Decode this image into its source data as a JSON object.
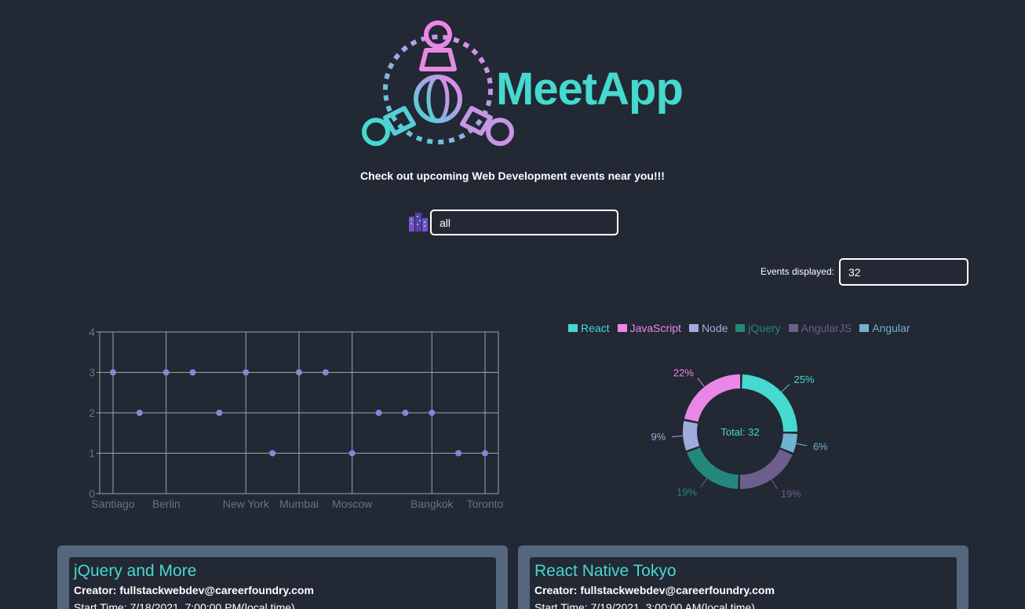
{
  "app": {
    "logo_text": "MeetApp",
    "tagline": "Check out upcoming Web Development events near you!!!"
  },
  "search": {
    "city_value": "all",
    "number_label": "Events displayed:",
    "number_value": "32"
  },
  "colors": {
    "accent": "#45d9cf",
    "background": "#222834",
    "card": "#54677f",
    "point": "#8884d8"
  },
  "scatter": {
    "chart_data": {
      "type": "scatter",
      "x": [
        "Santiago",
        "c2",
        "Berlin",
        "c4",
        "c5",
        "New York",
        "c7",
        "Mumbai",
        "c9",
        "Moscow",
        "c11",
        "c12",
        "Bangkok",
        "c14",
        "Toronto"
      ],
      "xtick_labels": [
        "Santiago",
        "Berlin",
        "New York",
        "Mumbai",
        "Moscow",
        "Bangkok",
        "Toronto"
      ],
      "y": [
        3,
        2,
        3,
        3,
        2,
        3,
        1,
        3,
        3,
        1,
        2,
        2,
        2,
        1,
        1
      ],
      "yticks": [
        "0",
        "1",
        "2",
        "3",
        "4"
      ],
      "ylim": [
        0,
        4
      ],
      "grid": true
    }
  },
  "pie": {
    "chart_data": {
      "type": "pie",
      "categories": [
        "React",
        "JavaScript",
        "Node",
        "jQuery",
        "AngularJS",
        "Angular"
      ],
      "values": [
        25,
        22,
        9,
        19,
        19,
        6
      ],
      "labels": [
        "25%",
        "22%",
        "9%",
        "19%",
        "19%",
        "6%"
      ],
      "colors": [
        "#45d9cf",
        "#ea87e6",
        "#a1acde",
        "#24877b",
        "#6e5e8c",
        "#6fb4cd"
      ],
      "center_label": "Total: 32",
      "legend": "top"
    }
  },
  "events": [
    {
      "title": "jQuery and More",
      "creator": "Creator: fullstackwebdev@careerfoundry.com",
      "start": "Start Time: 7/18/2021, 7:00:00 PM(local time)"
    },
    {
      "title": "React Native Tokyo",
      "creator": "Creator: fullstackwebdev@careerfoundry.com",
      "start": "Start Time: 7/19/2021, 3:00:00 AM(local time)"
    }
  ]
}
